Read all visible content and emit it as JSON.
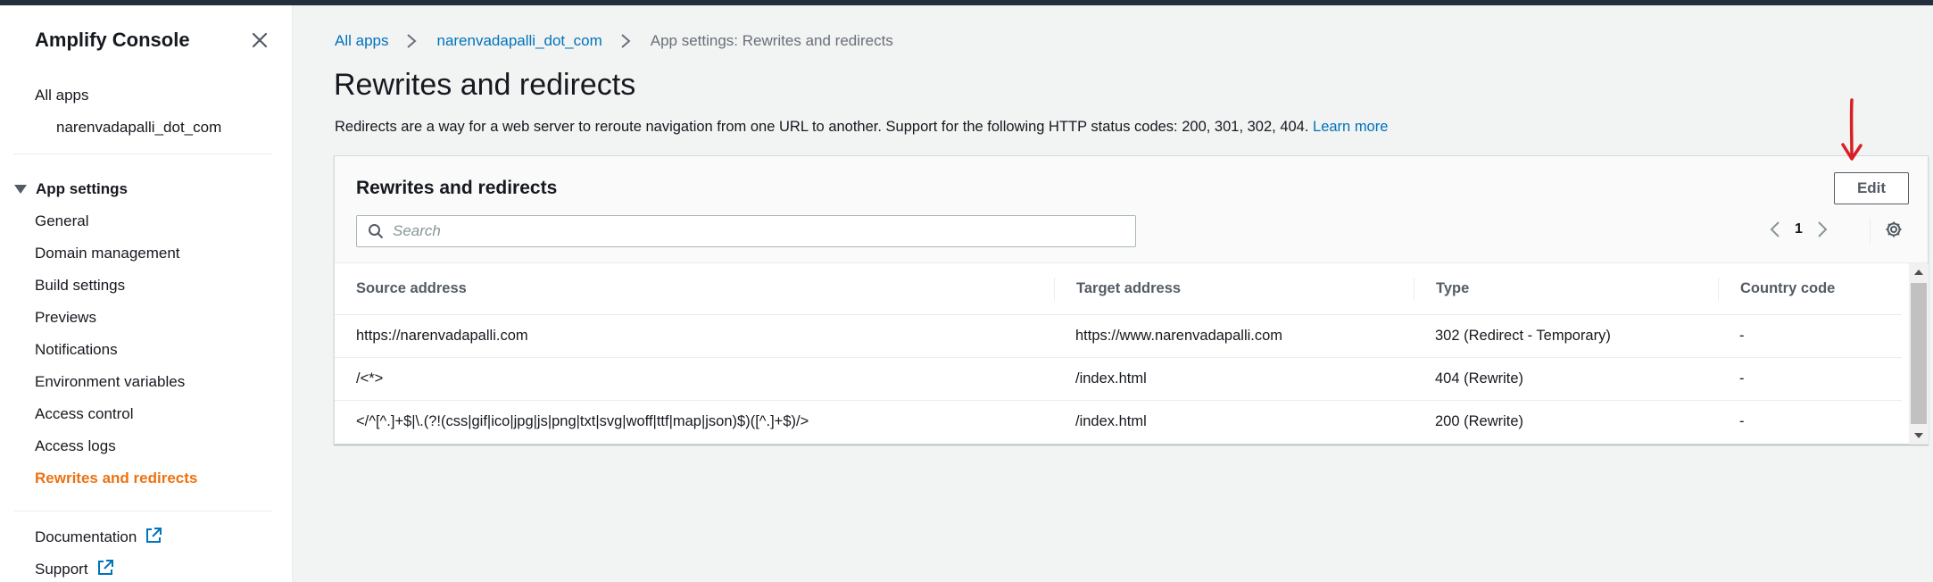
{
  "sidebar": {
    "title": "Amplify Console",
    "all_apps": "All apps",
    "app_name": "narenvadapalli_dot_com",
    "section_label": "App settings",
    "items": [
      {
        "label": "General"
      },
      {
        "label": "Domain management"
      },
      {
        "label": "Build settings"
      },
      {
        "label": "Previews"
      },
      {
        "label": "Notifications"
      },
      {
        "label": "Environment variables"
      },
      {
        "label": "Access control"
      },
      {
        "label": "Access logs"
      },
      {
        "label": "Rewrites and redirects",
        "active": true
      }
    ],
    "footer": [
      {
        "label": "Documentation",
        "icon": "external-link-icon"
      },
      {
        "label": "Support",
        "icon": "external-link-icon"
      }
    ]
  },
  "breadcrumb": {
    "items": [
      "All apps",
      "narenvadapalli_dot_com"
    ],
    "current": "App settings: Rewrites and redirects"
  },
  "page": {
    "title": "Rewrites and redirects",
    "description": "Redirects are a way for a web server to reroute navigation from one URL to another. Support for the following HTTP status codes: 200, 301, 302, 404.",
    "learn_more": "Learn more"
  },
  "panel": {
    "title": "Rewrites and redirects",
    "edit_label": "Edit",
    "search_placeholder": "Search",
    "page_number": "1"
  },
  "table": {
    "columns": [
      "Source address",
      "Target address",
      "Type",
      "Country code"
    ],
    "rows": [
      [
        "https://narenvadapalli.com",
        "https://www.narenvadapalli.com",
        "302 (Redirect - Temporary)",
        "-"
      ],
      [
        "/<*>",
        "/index.html",
        "404 (Rewrite)",
        "-"
      ],
      [
        "</^[^.]+$|\\.(?!(css|gif|ico|jpg|js|png|txt|svg|woff|ttf|map|json)$)([^.]+$)/>",
        "/index.html",
        "200 (Rewrite)",
        "-"
      ]
    ]
  },
  "colors": {
    "accent": "#ec7211",
    "link": "#0073bb",
    "annotation": "#d91f26"
  }
}
